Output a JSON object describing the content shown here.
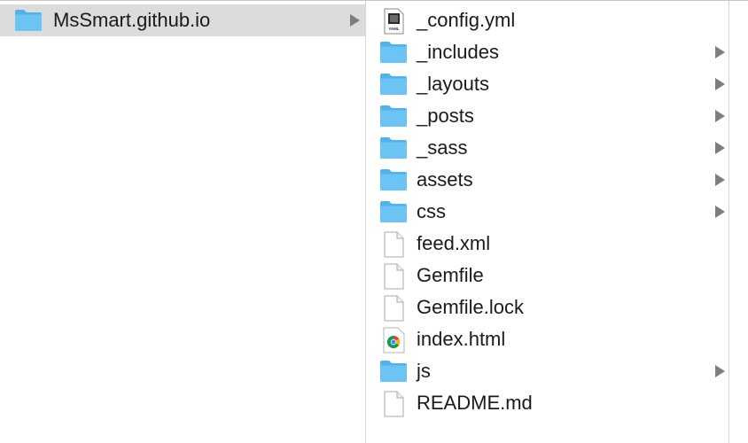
{
  "column1": {
    "items": [
      {
        "label": "MsSmart.github.io",
        "kind": "folder",
        "has_children": true,
        "selected": true
      }
    ]
  },
  "column2": {
    "items": [
      {
        "label": "_config.yml",
        "kind": "yaml-file",
        "has_children": false
      },
      {
        "label": "_includes",
        "kind": "folder",
        "has_children": true
      },
      {
        "label": "_layouts",
        "kind": "folder",
        "has_children": true
      },
      {
        "label": "_posts",
        "kind": "folder",
        "has_children": true
      },
      {
        "label": "_sass",
        "kind": "folder",
        "has_children": true
      },
      {
        "label": "assets",
        "kind": "folder",
        "has_children": true
      },
      {
        "label": "css",
        "kind": "folder",
        "has_children": true
      },
      {
        "label": "feed.xml",
        "kind": "document",
        "has_children": false
      },
      {
        "label": "Gemfile",
        "kind": "document",
        "has_children": false
      },
      {
        "label": "Gemfile.lock",
        "kind": "document",
        "has_children": false
      },
      {
        "label": "index.html",
        "kind": "chrome-html",
        "has_children": false
      },
      {
        "label": "js",
        "kind": "folder",
        "has_children": true
      },
      {
        "label": "README.md",
        "kind": "document",
        "has_children": false
      }
    ]
  },
  "colors": {
    "selection": "#dcdcdc",
    "folder_front": "#6cc4f5",
    "folder_back": "#4fb3ee",
    "arrow": "#7d7d7d",
    "text": "#1a1a1a"
  },
  "icons": {
    "folder": "folder-icon",
    "document": "document-icon",
    "yaml-file": "yaml-file-icon",
    "chrome-html": "chrome-html-file-icon"
  },
  "yaml_icon_text": "YAML"
}
